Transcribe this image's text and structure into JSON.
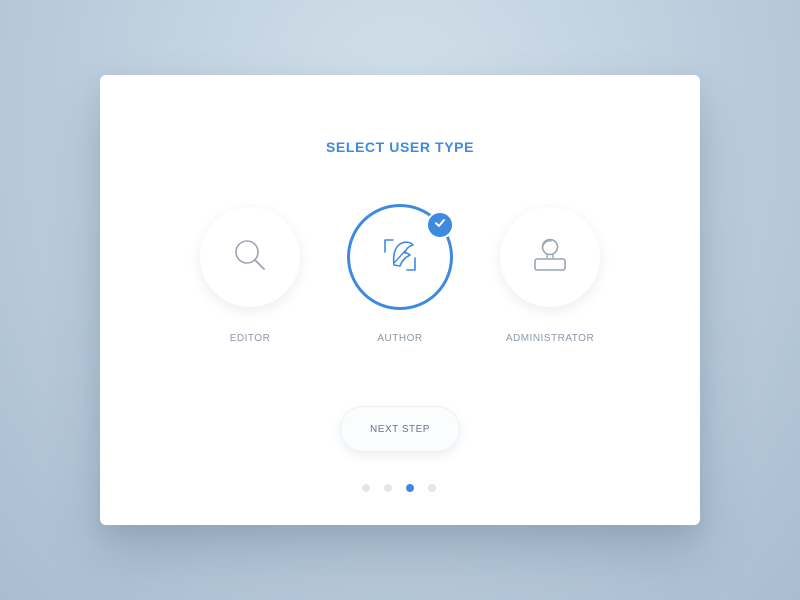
{
  "dialog": {
    "title": "SELECT USER TYPE",
    "options": [
      {
        "label": "EDITOR",
        "icon": "magnifier-icon",
        "selected": false
      },
      {
        "label": "AUTHOR",
        "icon": "quill-icon",
        "selected": true
      },
      {
        "label": "ADMINISTRATOR",
        "icon": "user-icon",
        "selected": false
      }
    ],
    "next_button": "NEXT STEP",
    "pagination": {
      "total": 4,
      "current": 3
    }
  },
  "colors": {
    "accent": "#3d8ae0",
    "label": "#8c98a8",
    "icon_stroke": "#9aa5b3",
    "dot_inactive": "#e3e7ec"
  }
}
